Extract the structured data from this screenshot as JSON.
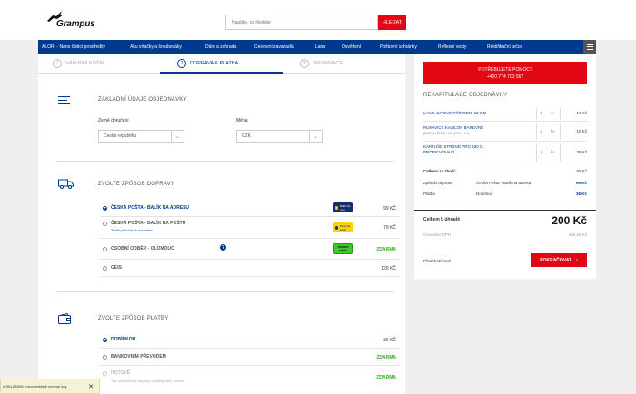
{
  "header": {
    "logo_text": "Grampus",
    "search_placeholder": "Napište, co hledáte",
    "search_button": "HLEDAT"
  },
  "nav": {
    "items": [
      "ALORI - Nano čisticí prostředky",
      "Aku vrtačky a šroubováky",
      "Dům a zahrada",
      "Cestovní zavazadla",
      "Lana",
      "Osvětlení",
      "Poštovní schránky",
      "Reflexní vesty",
      "Rektifikační tečce"
    ]
  },
  "steps": [
    {
      "num": "1",
      "label": "NÁKUPNÍ KOŠÍK"
    },
    {
      "num": "2",
      "label": "DOPRAVA & PLATBA"
    },
    {
      "num": "3",
      "label": "INFORMACE"
    }
  ],
  "basic": {
    "title": "ZÁKLADNÍ ÚDAJE OBJEDNÁVKY",
    "country_label": "Země doručení",
    "country_value": "Česká republika",
    "currency_label": "Měna",
    "currency_value": "CZK"
  },
  "shipping": {
    "title": "ZVOLTE ZPŮSOB DOPRAVY",
    "options": [
      {
        "label": "ČESKÁ POŠTA - BALÍK NA ADRESU",
        "price": "99 KČ",
        "badge": "Balík Do ruky"
      },
      {
        "label": "ČESKÁ POŠTA - BALÍK NA POŠTU",
        "sub": "Zvolit pobočku k doručení",
        "price": "79 KČ",
        "badge": "Balík Na poštu"
      },
      {
        "label": "OSOBNÍ ODBĚR - OLOMOUC",
        "price": "ZDARMA",
        "badge": "Osobní odběr",
        "info": "?"
      },
      {
        "label": "GEIS",
        "price": "129 KČ"
      }
    ]
  },
  "payment": {
    "title": "ZVOLTE ZPŮSOB PLATBY",
    "options": [
      {
        "label": "DOBÍRKOU",
        "price": "36 KČ"
      },
      {
        "label": "BANKOVNÍM PŘEVODEM",
        "price": "ZDARMA"
      },
      {
        "label": "HOTOVĚ",
        "sub": "Tato kombinace dopravy a platby není možná.",
        "price": "ZDARMA"
      }
    ]
  },
  "sidebar": {
    "help_title": "POTŘEBUJETE POMOC?",
    "help_phone": "+420 774 703 567",
    "recap_title": "REKAPITULACE OBJEDNÁVKY",
    "items": [
      {
        "name": "LANO JUTOVÉ PŘÍRODNÍ 12 MM",
        "qty": "1",
        "unit": "m",
        "price": "17 Kč"
      },
      {
        "name": "RUKAVICE KASILON BAREVNÉ",
        "sub": "(BARVA: ŠEDÁ, VELIKOST: 10)",
        "qty": "1",
        "unit": "ks",
        "price": "10 Kč"
      },
      {
        "name": "KARTUŠE STREND PRO 190 G, PROPICHOVACÍ",
        "qty": "1",
        "unit": "ks",
        "price": "38 Kč"
      }
    ],
    "goods_label": "Celkem za zboží:",
    "goods_value": "65 Kč",
    "shipping_label": "Způsob dopravy",
    "shipping_name": "Česká Pošta - balík na adresu",
    "shipping_value": "99 Kč",
    "payment_label": "Platba",
    "payment_name": "Dobírkou",
    "payment_value": "36 Kč",
    "total_label": "Celkem k úhradě",
    "total_value": "200 Kč",
    "novat_label": "Cena bez DPH",
    "novat_value": "165,29 Kč",
    "prev_label": "Předchozí krok",
    "continue_label": "POKRAČOVAT"
  },
  "cookie": {
    "text": "u SKLADEM a momentálně nevíme kdy",
    "close": "✕"
  },
  "colors": {
    "brand_blue": "#003a8f",
    "brand_red": "#e30613",
    "free_green": "#3cb028"
  }
}
